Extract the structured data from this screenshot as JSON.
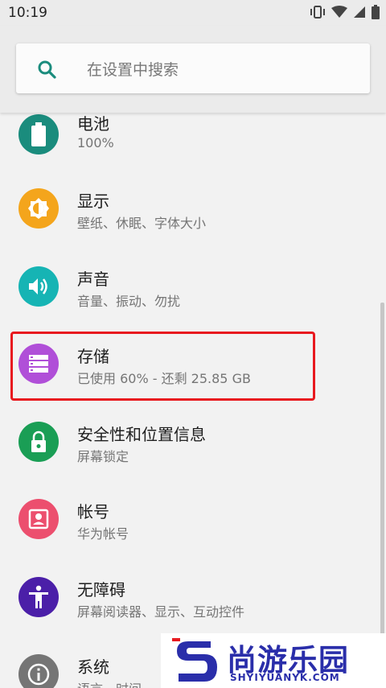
{
  "status_bar": {
    "time": "10:19",
    "icons": [
      "vibrate-icon",
      "wifi-icon",
      "signal-icon",
      "battery-icon"
    ]
  },
  "search": {
    "placeholder": "在设置中搜索"
  },
  "settings": [
    {
      "title": "电池",
      "subtitle": "100%",
      "color": "#1a8c7d",
      "icon": "battery-icon"
    },
    {
      "title": "显示",
      "subtitle": "壁纸、休眠、字体大小",
      "color": "#f4a51c",
      "icon": "brightness-icon"
    },
    {
      "title": "声音",
      "subtitle": "音量、振动、勿扰",
      "color": "#16b4b4",
      "icon": "volume-icon"
    },
    {
      "title": "存储",
      "subtitle": "已使用 60% - 还剩 25.85 GB",
      "color": "#b04fd8",
      "icon": "storage-icon"
    },
    {
      "title": "安全性和位置信息",
      "subtitle": "屏幕锁定",
      "color": "#1a9e55",
      "icon": "lock-icon"
    },
    {
      "title": "帐号",
      "subtitle": "华为帐号",
      "color": "#ec4f6e",
      "icon": "account-icon"
    },
    {
      "title": "无障碍",
      "subtitle": "屏幕阅读器、显示、互动控件",
      "color": "#4b1fa8",
      "icon": "accessibility-icon"
    },
    {
      "title": "系统",
      "subtitle": "语言、时间",
      "color": "#757575",
      "icon": "info-icon"
    }
  ],
  "watermark": {
    "brand": "尚游乐园",
    "domain": "SHYIYUANYK.COM"
  }
}
